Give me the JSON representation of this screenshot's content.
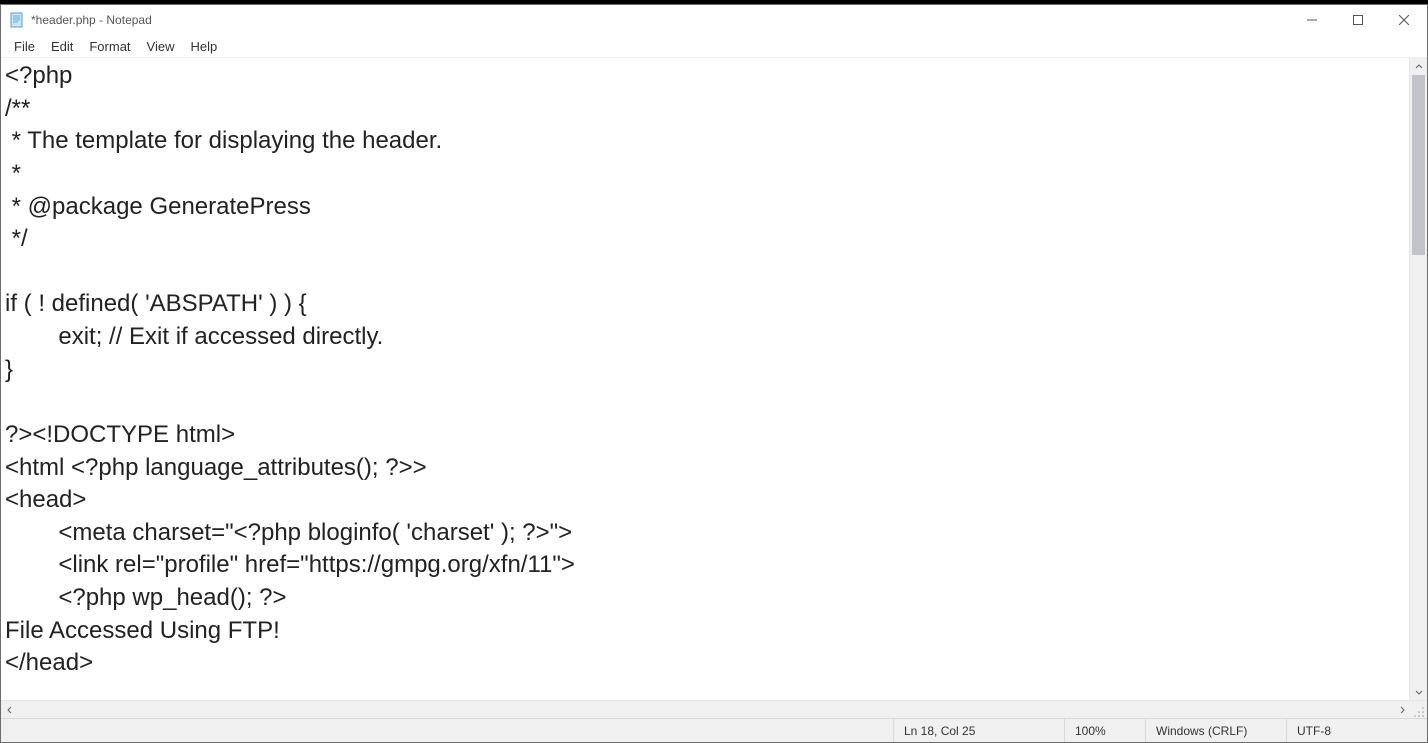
{
  "window": {
    "title": "*header.php - Notepad"
  },
  "menu": {
    "file": "File",
    "edit": "Edit",
    "format": "Format",
    "view": "View",
    "help": "Help"
  },
  "editor": {
    "content": "<?php\n/**\n * The template for displaying the header.\n *\n * @package GeneratePress\n */\n\nif ( ! defined( 'ABSPATH' ) ) {\n\texit; // Exit if accessed directly.\n}\n\n?><!DOCTYPE html>\n<html <?php language_attributes(); ?>>\n<head>\n\t<meta charset=\"<?php bloginfo( 'charset' ); ?>\">\n\t<link rel=\"profile\" href=\"https://gmpg.org/xfn/11\">\n\t<?php wp_head(); ?>\nFile Accessed Using FTP!\n</head>"
  },
  "status": {
    "position": "Ln 18, Col 25",
    "zoom": "100%",
    "line_ending": "Windows (CRLF)",
    "encoding": "UTF-8"
  }
}
